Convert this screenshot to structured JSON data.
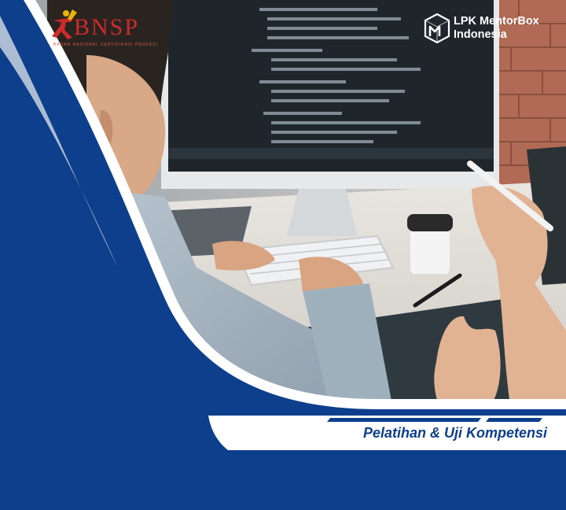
{
  "partner": {
    "name": "BNSP",
    "subtitle": "BADAN NASIONAL SERTIFIKASI PROFESI"
  },
  "brand": {
    "line1": "LPK MentorBox",
    "line2": "Indonesia"
  },
  "tagline": "Pelatihan & Uji Kompetensi",
  "colors": {
    "primary_blue": "#0d3f8c",
    "white": "#ffffff",
    "bnsp_red": "#cf2a2a",
    "bnsp_gold": "#e8b400"
  }
}
